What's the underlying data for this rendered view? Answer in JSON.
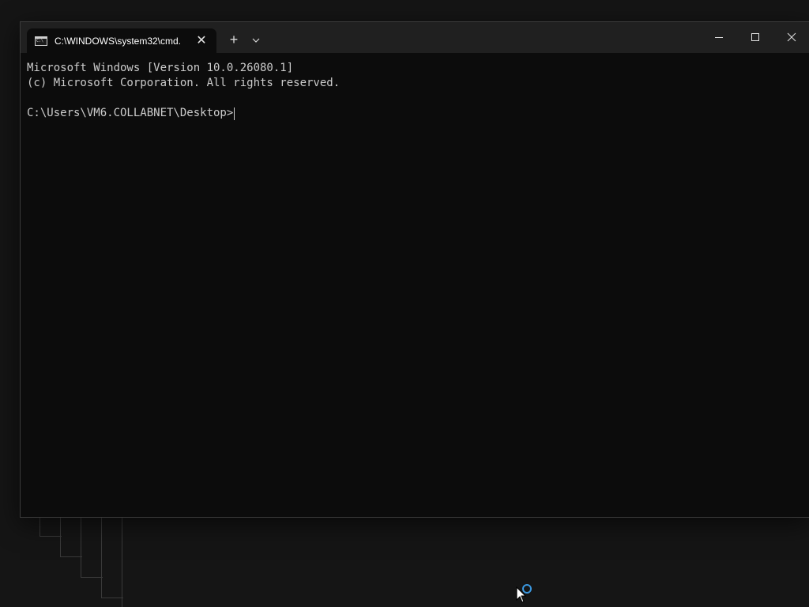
{
  "window": {
    "tab": {
      "title": "C:\\WINDOWS\\system32\\cmd.",
      "icon": "cmd-icon"
    },
    "tab_close_symbol": "✕",
    "new_tab_symbol": "+",
    "dropdown_icon": "chevron-down-icon",
    "controls": [
      "minimize-icon",
      "maximize-icon",
      "close-icon"
    ]
  },
  "terminal": {
    "lines": [
      "Microsoft Windows [Version 10.0.26080.1]",
      "(c) Microsoft Corporation. All rights reserved.",
      ""
    ],
    "prompt": "C:\\Users\\VM6.COLLABNET\\Desktop>"
  },
  "colors": {
    "terminal_bg": "#0c0c0c",
    "terminal_text": "#cccccc",
    "titlebar_bg": "#202020",
    "busy_indicator": "#3a96dd"
  }
}
